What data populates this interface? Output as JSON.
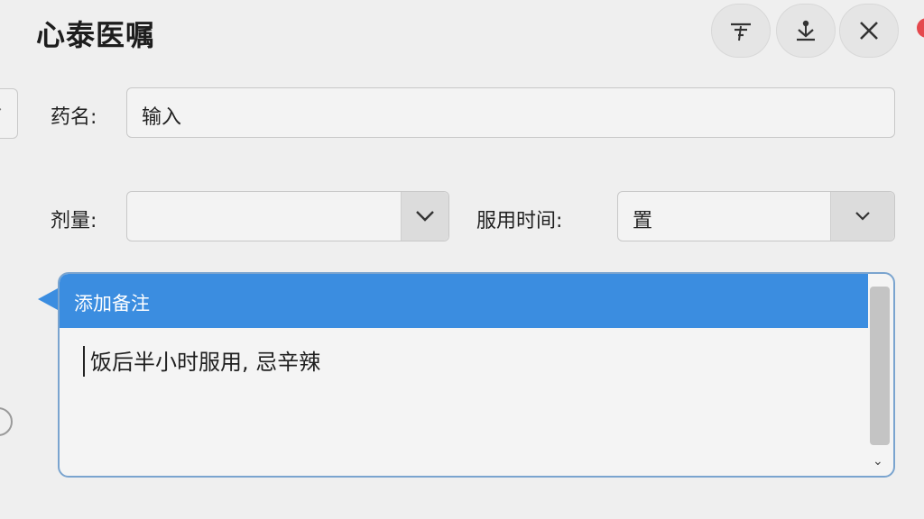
{
  "window": {
    "title": "心泰医嘱",
    "buttons": [
      {
        "name": "filter",
        "icon": "filter-icon"
      },
      {
        "name": "pin",
        "icon": "pin-icon"
      },
      {
        "name": "close",
        "icon": "close-icon"
      }
    ]
  },
  "form": {
    "drug_name": {
      "label": "药名:",
      "value": "输入"
    },
    "dose": {
      "label": "剂量:",
      "value": ""
    },
    "time": {
      "label": "服用时间:",
      "value": "置"
    }
  },
  "note": {
    "header": "添加备注",
    "text": "饭后半小时服用, 忌辛辣"
  },
  "colors": {
    "accent": "#3b8de0",
    "close_badge": "#e5484d"
  }
}
